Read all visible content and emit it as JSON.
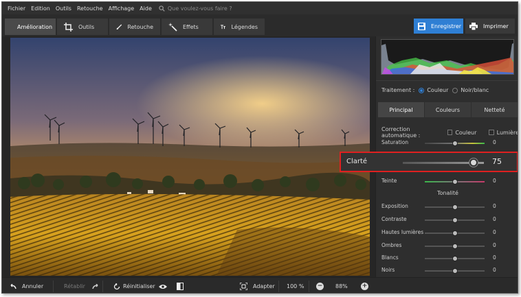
{
  "menubar": {
    "items": [
      "Fichier",
      "Edition",
      "Outils",
      "Retouche",
      "Affichage",
      "Aide"
    ],
    "search_placeholder": "Que voulez-vous faire ?"
  },
  "toolbar": {
    "tabs": [
      {
        "label": "Amélioration",
        "icon": "sliders-icon",
        "active": true
      },
      {
        "label": "Outils",
        "icon": "crop-icon",
        "active": false
      },
      {
        "label": "Retouche",
        "icon": "brush-icon",
        "active": false
      },
      {
        "label": "Effets",
        "icon": "magic-wand-icon",
        "active": false
      },
      {
        "label": "Légendes",
        "icon": "text-icon",
        "active": false
      }
    ],
    "save_label": "Enregistrer",
    "print_label": "Imprimer",
    "accent_color": "#2f7fd4"
  },
  "panel": {
    "treatment_label": "Traitement :",
    "treatment_options": [
      {
        "label": "Couleur",
        "selected": true
      },
      {
        "label": "Noir/blanc",
        "selected": false
      }
    ],
    "tabs": [
      {
        "label": "Principal",
        "active": true
      },
      {
        "label": "Couleurs",
        "active": false
      },
      {
        "label": "Netteté",
        "active": false
      }
    ],
    "auto_correction_label": "Correction automatique :",
    "auto_options": [
      {
        "label": "Couleur",
        "checked": false
      },
      {
        "label": "Lumière",
        "checked": false
      }
    ],
    "sliders_main": [
      {
        "label": "Saturation",
        "value": "0",
        "position": 0.5
      },
      {
        "label": "Teinte",
        "value": "0",
        "position": 0.5
      }
    ],
    "section_tonality": "Tonalité",
    "sliders_tonality": [
      {
        "label": "Exposition",
        "value": "0",
        "position": 0.5
      },
      {
        "label": "Contraste",
        "value": "0",
        "position": 0.5
      },
      {
        "label": "Hautes lumières",
        "value": "0",
        "position": 0.5
      },
      {
        "label": "Ombres",
        "value": "0",
        "position": 0.5
      },
      {
        "label": "Blancs",
        "value": "0",
        "position": 0.5
      },
      {
        "label": "Noirs",
        "value": "0",
        "position": 0.5
      }
    ]
  },
  "callout": {
    "label": "Clarté",
    "value": "75",
    "position": 0.875,
    "border_color": "#e02020"
  },
  "bottombar": {
    "undo_label": "Annuler",
    "redo_label": "Rétablir",
    "reset_label": "Réinitialiser",
    "fit_label": "Adapter",
    "zoom_100": "100 %",
    "zoom_current": "88%"
  }
}
